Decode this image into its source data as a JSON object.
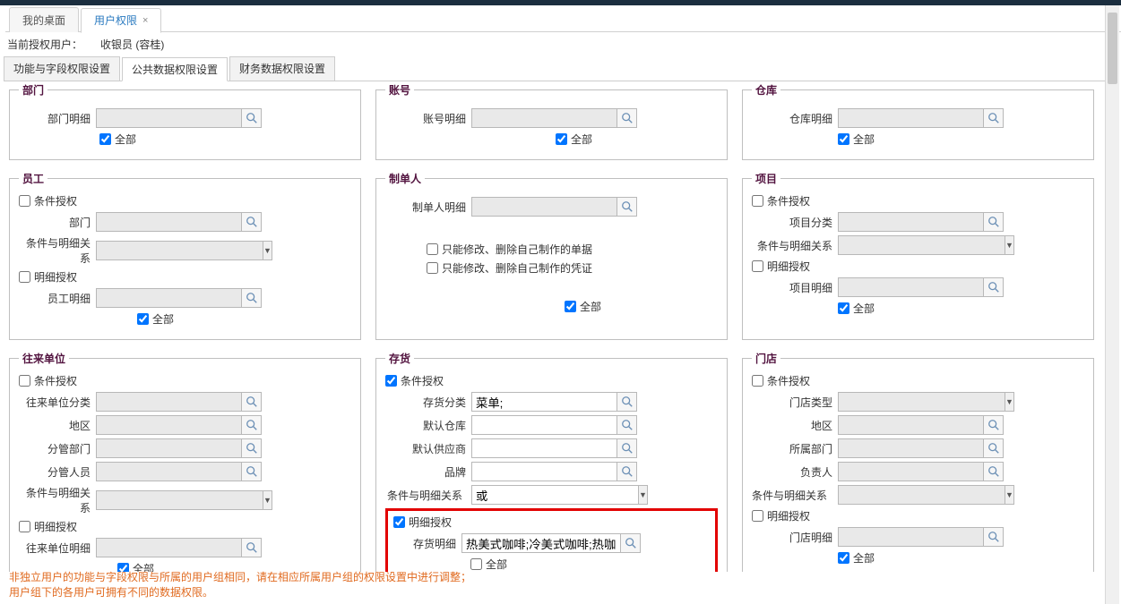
{
  "tabs": {
    "desktop": "我的桌面",
    "user_perm": "用户权限"
  },
  "userline": {
    "label": "当前授权用户：",
    "value": "收银员 (容桂)"
  },
  "subtabs": {
    "func_field": "功能与字段权限设置",
    "public_data": "公共数据权限设置",
    "finance_data": "财务数据权限设置"
  },
  "panels": {
    "dept": {
      "legend": "部门",
      "detail_label": "部门明细",
      "all": "全部"
    },
    "account": {
      "legend": "账号",
      "detail_label": "账号明细",
      "all": "全部"
    },
    "warehouse": {
      "legend": "仓库",
      "detail_label": "仓库明细",
      "all": "全部"
    },
    "employee": {
      "legend": "员工",
      "cond_auth": "条件授权",
      "dept_label": "部门",
      "relation_label": "条件与明细关系",
      "detail_auth": "明细授权",
      "detail_label": "员工明细",
      "all": "全部"
    },
    "maker": {
      "legend": "制单人",
      "detail_label": "制单人明细",
      "only_own_doc": "只能修改、删除自己制作的单据",
      "only_own_voucher": "只能修改、删除自己制作的凭证",
      "all": "全部"
    },
    "project": {
      "legend": "项目",
      "cond_auth": "条件授权",
      "category_label": "项目分类",
      "relation_label": "条件与明细关系",
      "detail_auth": "明细授权",
      "detail_label": "项目明细",
      "all": "全部"
    },
    "partner": {
      "legend": "往来单位",
      "cond_auth": "条件授权",
      "category_label": "往来单位分类",
      "region_label": "地区",
      "dept_label": "分管部门",
      "person_label": "分管人员",
      "relation_label": "条件与明细关系",
      "detail_auth": "明细授权",
      "detail_label": "往来单位明细",
      "all": "全部"
    },
    "inventory": {
      "legend": "存货",
      "cond_auth": "条件授权",
      "category_label": "存货分类",
      "category_value": "菜单;",
      "default_wh_label": "默认仓库",
      "default_supplier_label": "默认供应商",
      "brand_label": "品牌",
      "relation_label": "条件与明细关系",
      "relation_value": "或",
      "detail_auth": "明细授权",
      "detail_label": "存货明细",
      "detail_value": "热美式咖啡;冷美式咖啡;热咖啡!",
      "all": "全部"
    },
    "shop": {
      "legend": "门店",
      "cond_auth": "条件授权",
      "type_label": "门店类型",
      "region_label": "地区",
      "dept_label": "所属部门",
      "person_label": "负责人",
      "relation_label": "条件与明细关系",
      "detail_auth": "明细授权",
      "detail_label": "门店明细",
      "all": "全部"
    }
  },
  "footer": {
    "line1": "非独立用户的功能与字段权限与所属的用户组相同，请在相应所属用户组的权限设置中进行调整；",
    "line2": "用户组下的各用户可拥有不同的数据权限。"
  }
}
